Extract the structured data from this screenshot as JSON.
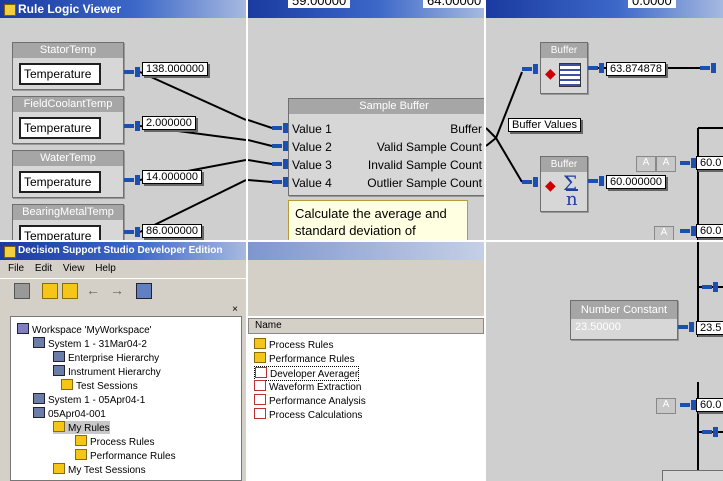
{
  "top_strip": {
    "left_value": "59.00000",
    "right_value": "64.00000",
    "right_cut": "0.0000"
  },
  "viewer": {
    "title": "Rule Logic Viewer",
    "inputs": [
      {
        "header": "StatorTemp",
        "field": "Temperature",
        "value": "138.000000"
      },
      {
        "header": "FieldCoolantTemp",
        "field": "Temperature",
        "value": "2.000000"
      },
      {
        "header": "WaterTemp",
        "field": "Temperature",
        "value": "14.000000"
      },
      {
        "header": "BearingMetalTemp",
        "field": "Temperature",
        "value": "86.000000"
      }
    ],
    "sample_buffer": {
      "header": "Sample Buffer",
      "inputs": [
        "Value 1",
        "Value 2",
        "Value 3",
        "Value 4"
      ],
      "outputs": [
        "Buffer",
        "Valid Sample Count",
        "Invalid Sample Count",
        "Outlier Sample Count"
      ]
    },
    "note": "Calculate the average and standard deviation of",
    "buffer_values_label": "Buffer Values",
    "buffer_nodes": [
      {
        "header": "Buffer",
        "value": "63.874878"
      },
      {
        "header": "Buffer",
        "value": "60.000000",
        "symbol_top": "Σ",
        "symbol_bottom": "n"
      }
    ],
    "small_buttons": [
      "A",
      "A",
      "A",
      "A",
      "A"
    ],
    "cut_values": [
      "60.0",
      "60.0",
      "23.5",
      "60.0"
    ],
    "number_constant": {
      "header": "Number Constant",
      "value": "23.50000"
    }
  },
  "dss": {
    "title": "Decision Support Studio Developer Edition",
    "menu": [
      "File",
      "Edit",
      "View",
      "Help"
    ],
    "tree": [
      {
        "label": "Workspace 'MyWorkspace'",
        "icon": "workspace-icon"
      },
      {
        "label": "System 1 - 31Mar04-2",
        "icon": "system-icon"
      },
      {
        "label": "Enterprise Hierarchy",
        "icon": "hierarchy-icon"
      },
      {
        "label": "Instrument Hierarchy",
        "icon": "hierarchy-icon"
      },
      {
        "label": "Test Sessions",
        "icon": "folder-icon"
      },
      {
        "label": "System 1 - 05Apr04-1",
        "icon": "system-icon"
      },
      {
        "label": "05Apr04-001",
        "icon": "system-icon"
      },
      {
        "label": "My Rules",
        "icon": "folder-icon"
      },
      {
        "label": "Process Rules",
        "icon": "folder-icon"
      },
      {
        "label": "Performance Rules",
        "icon": "folder-icon"
      },
      {
        "label": "My Test Sessions",
        "icon": "folder-icon"
      }
    ],
    "list_header": "Name",
    "list": [
      {
        "label": "Process Rules",
        "icon": "folder-icon"
      },
      {
        "label": "Performance Rules",
        "icon": "folder-icon"
      },
      {
        "label": "Developer Averager",
        "icon": "rule-icon"
      },
      {
        "label": "Waveform Extraction",
        "icon": "rule-icon"
      },
      {
        "label": "Performance Analysis",
        "icon": "rule-icon"
      },
      {
        "label": "Process Calculations",
        "icon": "rule-icon"
      }
    ]
  }
}
